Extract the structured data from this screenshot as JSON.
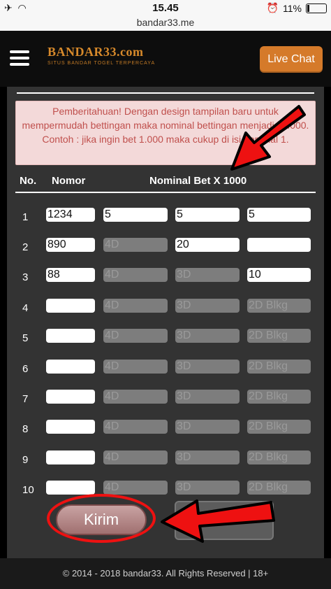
{
  "status_bar": {
    "time": "15.45",
    "url": "bandar33.me",
    "battery": "11%"
  },
  "header": {
    "brand": "BANDAR33.com",
    "tagline": "SITUS BANDAR TOGEL TERPERCAYA",
    "live_chat": "Live Chat"
  },
  "notice": {
    "text": "Pemberitahuan! Dengan design tampilan baru untuk mempermudah bettingan maka nominal bettingan menjadi x1.000. Contoh : jika ingin bet 1.000 maka cukup di isi nominal 1."
  },
  "table": {
    "headers": {
      "no": "No.",
      "nomor": "Nomor",
      "bet": "Nominal Bet X 1000"
    },
    "rows": [
      {
        "no": "1",
        "nomor": "1234",
        "f1": "5",
        "f2": "5",
        "f3": "5"
      },
      {
        "no": "2",
        "nomor": "890",
        "f1": "4D",
        "f2": "20",
        "f3": ""
      },
      {
        "no": "3",
        "nomor": "88",
        "f1": "4D",
        "f2": "3D",
        "f3": "10"
      },
      {
        "no": "4",
        "nomor": "",
        "f1": "4D",
        "f2": "3D",
        "f3": "2D Blkg"
      },
      {
        "no": "5",
        "nomor": "",
        "f1": "4D",
        "f2": "3D",
        "f3": "2D Blkg"
      },
      {
        "no": "6",
        "nomor": "",
        "f1": "4D",
        "f2": "3D",
        "f3": "2D Blkg"
      },
      {
        "no": "7",
        "nomor": "",
        "f1": "4D",
        "f2": "3D",
        "f3": "2D Blkg"
      },
      {
        "no": "8",
        "nomor": "",
        "f1": "4D",
        "f2": "3D",
        "f3": "2D Blkg"
      },
      {
        "no": "9",
        "nomor": "",
        "f1": "4D",
        "f2": "3D",
        "f3": "2D Blkg"
      },
      {
        "no": "10",
        "nomor": "",
        "f1": "4D",
        "f2": "3D",
        "f3": "2D Blkg"
      }
    ]
  },
  "actions": {
    "submit": "Kirim"
  },
  "footer": {
    "text": "© 2014 - 2018 bandar33. All Rights Reserved | 18+"
  },
  "colors": {
    "accent": "#d57a2a",
    "annotation": "#e11111",
    "notice_text": "#c0504d"
  }
}
